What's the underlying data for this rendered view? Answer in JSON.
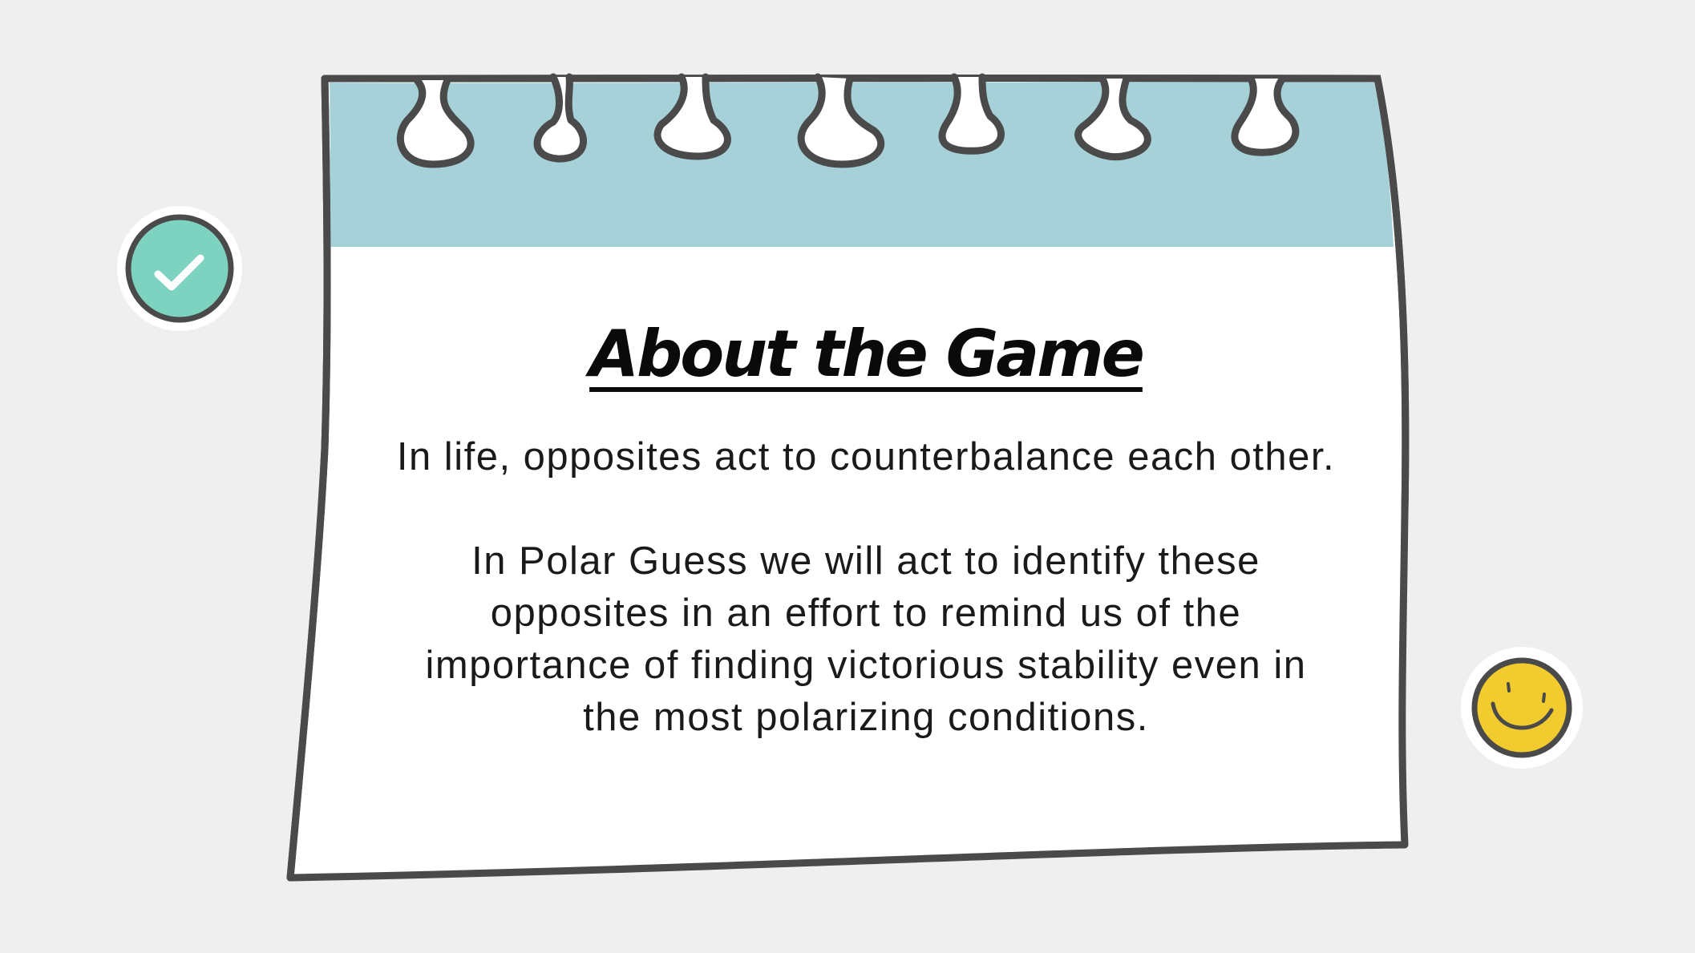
{
  "slide": {
    "title": "About the Game",
    "intro": "In life, opposites act to counterbalance each other.",
    "body": "In Polar Guess we will act to identify these opposites in an effort to remind us of the importance of finding victorious stability even in the most polarizing conditions."
  },
  "colors": {
    "background": "#efefef",
    "header_band": "#a7d1d9",
    "outline": "#4a4a4a",
    "check_badge": "#7ed3c0",
    "smiley_badge": "#f2cb2f"
  },
  "icons": {
    "check": "check-badge-icon",
    "smiley": "smiley-badge-icon"
  }
}
